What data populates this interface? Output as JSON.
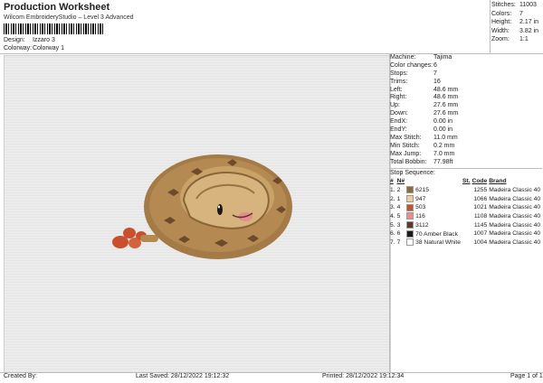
{
  "header": {
    "title": "Production Worksheet",
    "subtitle": "Wilcom EmbroideryStudio – Level 3 Advanced",
    "design_label": "Design:",
    "design_value": "Izzaro 3",
    "colorway_label": "Colorway:",
    "colorway_value": "Colorway 1"
  },
  "top_stats": [
    {
      "label": "Stitches:",
      "value": "11003"
    },
    {
      "label": "Colors:",
      "value": "7"
    },
    {
      "label": "Height:",
      "value": "2.17 in"
    },
    {
      "label": "Width:",
      "value": "3.82 in"
    },
    {
      "label": "Zoom:",
      "value": "1:1"
    }
  ],
  "machine_info": [
    {
      "label": "Machine:",
      "value": "Tajima"
    },
    {
      "label": "Color changes:",
      "value": "6"
    },
    {
      "label": "Stops:",
      "value": "7"
    },
    {
      "label": "Trims:",
      "value": "16"
    },
    {
      "label": "Left:",
      "value": "48.6 mm"
    },
    {
      "label": "Right:",
      "value": "48.6 mm"
    },
    {
      "label": "Up:",
      "value": "27.6 mm"
    },
    {
      "label": "Down:",
      "value": "27.6 mm"
    },
    {
      "label": "EndX:",
      "value": "0.00 in"
    },
    {
      "label": "EndY:",
      "value": "0.00 in"
    },
    {
      "label": "Max Stitch:",
      "value": "11.0 mm"
    },
    {
      "label": "Min Stitch:",
      "value": "0.2 mm"
    },
    {
      "label": "Max Jump:",
      "value": "7.0 mm"
    },
    {
      "label": "Total Bobbin:",
      "value": "77.98ft"
    }
  ],
  "stop_sequence": {
    "title": "Stop Sequence:",
    "headers": [
      "#",
      "N#",
      "",
      "St.",
      "Code",
      "Brand"
    ],
    "rows": [
      {
        "num": "1.",
        "n": "2",
        "color": "#8f6a3e",
        "name": "6215",
        "st": "1255",
        "code": "",
        "brand": "Madeira Classic 40"
      },
      {
        "num": "2.",
        "n": "1",
        "color": "#f2cc9a",
        "name": "947",
        "st": "1066",
        "code": "",
        "brand": "Madeira Classic 40"
      },
      {
        "num": "3.",
        "n": "4",
        "color": "#c8502c",
        "name": "503",
        "st": "1021",
        "code": "",
        "brand": "Madeira Classic 40"
      },
      {
        "num": "4.",
        "n": "5",
        "color": "#e58e8e",
        "name": "116",
        "st": "1108",
        "code": "",
        "brand": "Madeira Classic 40"
      },
      {
        "num": "5.",
        "n": "3",
        "color": "#5a3a26",
        "name": "3112",
        "st": "1145",
        "code": "",
        "brand": "Madeira Classic 40"
      },
      {
        "num": "6.",
        "n": "6",
        "color": "#1a1a1a",
        "name": "70  Amber Black",
        "st": "1007",
        "code": "",
        "brand": "Madeira Classic 40"
      },
      {
        "num": "7.",
        "n": "7",
        "color": "#ffffff",
        "name": "38  Natural White",
        "st": "1004",
        "code": "",
        "brand": "Madeira Classic 40"
      }
    ]
  },
  "footer": {
    "created_by": "Created By:",
    "last_saved": "Last Saved: 28/12/2022 19:12:32",
    "printed": "Printed: 28/12/2022 19:12:34",
    "page": "Page 1 of 1"
  },
  "colors": {
    "snake_body": "#b48a52",
    "snake_light": "#d7b47e",
    "tail": "#c8502c",
    "spots": "#6e4a2c"
  }
}
